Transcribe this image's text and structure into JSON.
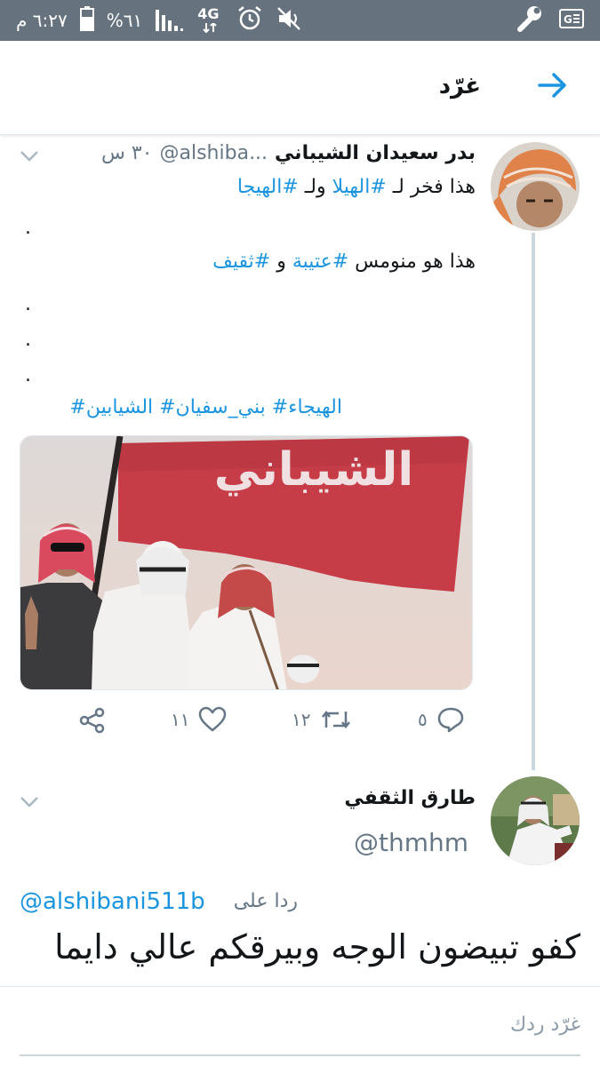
{
  "status_bar": {
    "time": "٦:٢٧ م",
    "battery_percent": "%٦١",
    "network": "4G",
    "icons": [
      "battery-icon",
      "signal-icon",
      "4g-icon",
      "alarm-icon",
      "mute-icon",
      "wrench-icon",
      "translate-icon"
    ]
  },
  "header": {
    "title": "غرّد",
    "back_icon": "arrow-right-icon"
  },
  "tweet": {
    "author_name": "بدر سعيدان الشيباني",
    "handle": "...alshiba@",
    "time": "٣٠ س",
    "line1_text": "هذا فخر لـ",
    "line1_tag1": "#الهيلا",
    "line1_mid": "ولـ",
    "line1_tag2": "#الهيجا",
    "dot": ".",
    "line2_text": "هذا هو منومس",
    "line2_tag1": "#عتيبة",
    "line2_mid": "و",
    "line2_tag2": "#ثقيف",
    "hashtags_line": "الهيجاء# بني_سفيان# الشيابين#",
    "media_banner_text": "الشيباني",
    "actions": {
      "reply_count": "٥",
      "retweet_count": "١٢",
      "like_count": "١١"
    }
  },
  "reply_tweet": {
    "author_name": "طارق الثقفي",
    "handle": "@thmhm",
    "reply_prefix": "ردا على",
    "reply_handle": "@alshibani511b",
    "text": "كفو تبيضون الوجه وبيرقكم عالي دايما"
  },
  "compose": {
    "placeholder": "غرّد ردك"
  },
  "colors": {
    "link": "#1b95e0",
    "status_bar": "#66727e",
    "muted": "#657786"
  }
}
